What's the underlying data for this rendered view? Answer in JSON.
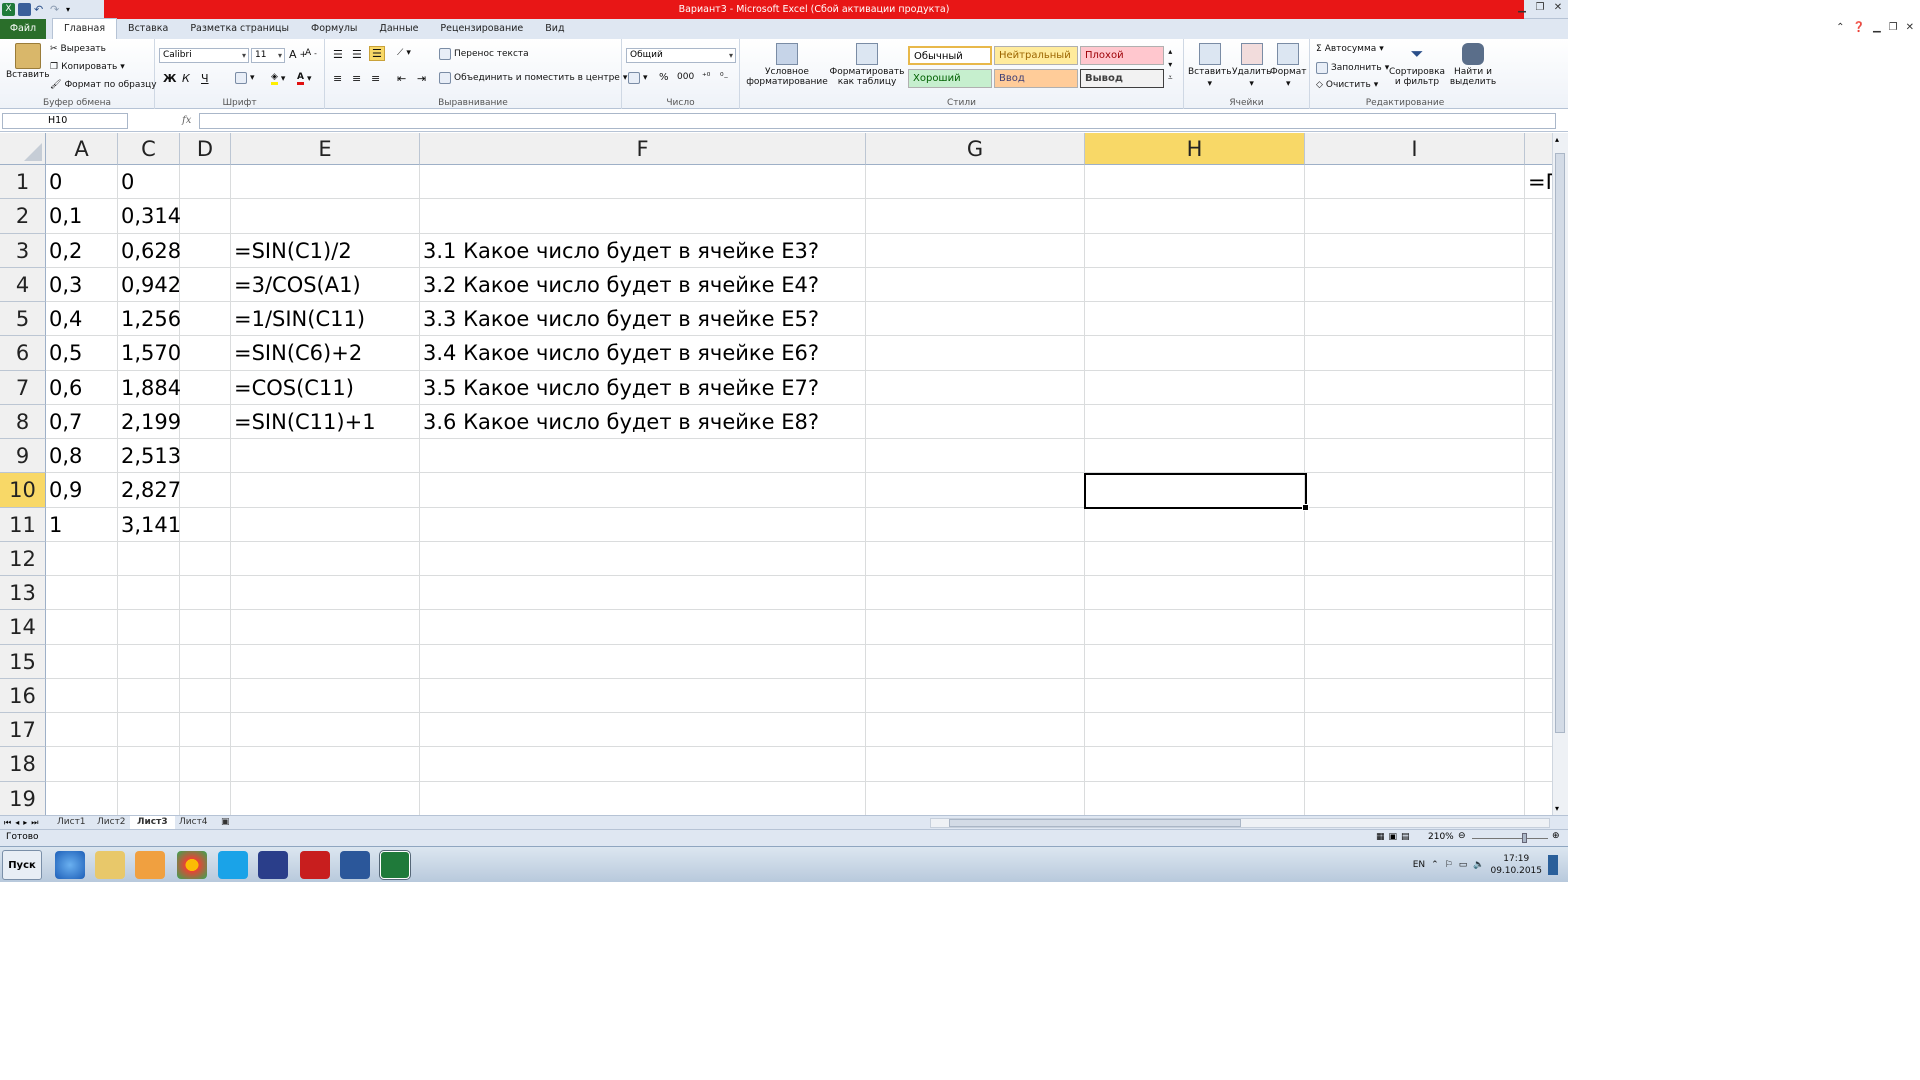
{
  "window": {
    "title": "Вариант3 - Microsoft Excel (Сбой активации продукта)"
  },
  "tabs": [
    "Файл",
    "Главная",
    "Вставка",
    "Разметка страницы",
    "Формулы",
    "Данные",
    "Рецензирование",
    "Вид"
  ],
  "ribbon": {
    "clipboard": {
      "paste": "Вставить",
      "cut": "Вырезать",
      "copy": "Копировать",
      "format_painter": "Формат по образцу",
      "label": "Буфер обмена"
    },
    "font": {
      "name": "Calibri",
      "size": "11",
      "bold": "Ж",
      "italic": "К",
      "underline": "Ч",
      "label": "Шрифт"
    },
    "alignment": {
      "wrap": "Перенос текста",
      "merge": "Объединить и поместить в центре",
      "label": "Выравнивание"
    },
    "number": {
      "format": "Общий",
      "percent": "%",
      "thousands": "000",
      "label": "Число"
    },
    "styles": {
      "conditional": "Условное форматирование",
      "as_table": "Форматировать как таблицу",
      "normal": "Обычный",
      "neutral": "Нейтральный",
      "bad": "Плохой",
      "good": "Хороший",
      "input": "Ввод",
      "output": "Вывод",
      "label": "Стили"
    },
    "cells": {
      "insert": "Вставить",
      "delete": "Удалить",
      "format": "Формат",
      "label": "Ячейки"
    },
    "editing": {
      "autosum": "Автосумма",
      "fill": "Заполнить",
      "clear": "Очистить",
      "sort": "Сортировка и фильтр",
      "find": "Найти и выделить",
      "label": "Редактирование"
    }
  },
  "formula_bar": {
    "name_box": "H10",
    "fx": "fx",
    "formula": ""
  },
  "columns": [
    "A",
    "C",
    "D",
    "E",
    "F",
    "G",
    "H",
    "I"
  ],
  "rows": [
    "1",
    "2",
    "3",
    "4",
    "5",
    "6",
    "7",
    "8",
    "9",
    "10",
    "11",
    "12",
    "13",
    "14",
    "15",
    "16",
    "17",
    "18",
    "19"
  ],
  "cells": {
    "A": [
      "0",
      "0,1",
      "0,2",
      "0,3",
      "0,4",
      "0,5",
      "0,6",
      "0,7",
      "0,8",
      "0,9",
      "1"
    ],
    "C": [
      "0",
      "0,314",
      "0,628",
      "0,942",
      "1,256",
      "1,570",
      "1,884",
      "2,199",
      "2,513",
      "2,827",
      "3,141"
    ],
    "E": [
      "=SIN(C1)/2",
      "=3/COS(A1)",
      "=1/SIN(C11)",
      "=SIN(C6)+2",
      "=COS(C11)",
      "=SIN(C11)+1"
    ],
    "F": [
      "3.1 Какое число будет в ячейке E3?",
      "3.2 Какое число будет в ячейке E4?",
      "3.3 Какое число будет в ячейке E5?",
      "3.4 Какое число будет в ячейке E6?",
      "3.5 Какое число будет в ячейке E7?",
      "3.6 Какое число будет в ячейке E8?"
    ],
    "J1": "=Г"
  },
  "sheets": [
    "Лист1",
    "Лист2",
    "Лист3",
    "Лист4"
  ],
  "status": {
    "ready": "Готово",
    "zoom": "210%"
  },
  "taskbar": {
    "start": "Пуск",
    "lang": "EN",
    "time": "17:19",
    "date": "09.10.2015"
  },
  "colors": {
    "title_red": "#e81616",
    "file_tab": "#2a6e2a",
    "selected_header": "#f8d867"
  }
}
